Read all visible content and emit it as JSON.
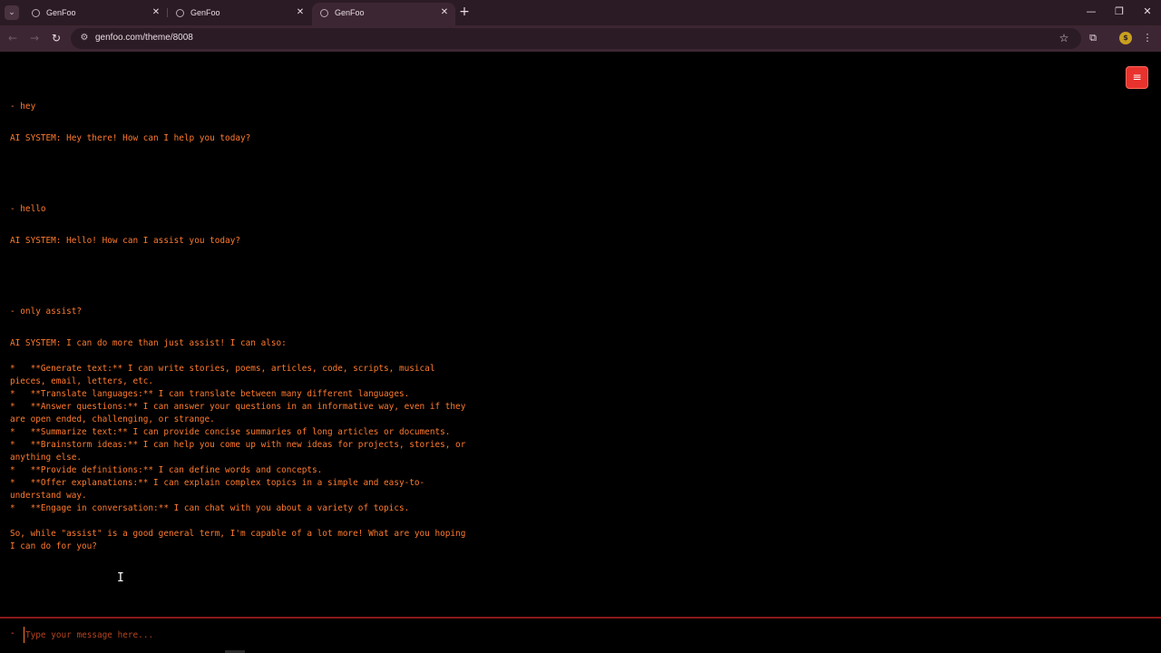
{
  "browser": {
    "tabs": [
      {
        "title": "GenFoo",
        "active": false
      },
      {
        "title": "GenFoo",
        "active": false
      },
      {
        "title": "GenFoo",
        "active": true
      }
    ],
    "url": "genfoo.com/theme/8008"
  },
  "chat": {
    "messages": [
      {
        "role": "user",
        "text": "- hey"
      },
      {
        "role": "ai",
        "text": "AI SYSTEM: Hey there! How can I help you today?"
      },
      {
        "role": "user",
        "text": "- hello"
      },
      {
        "role": "ai",
        "text": "AI SYSTEM: Hello! How can I assist you today?"
      },
      {
        "role": "user",
        "text": "- only assist?"
      },
      {
        "role": "ai",
        "text": "AI SYSTEM: I can do more than just assist! I can also:\n\n*   **Generate text:** I can write stories, poems, articles, code, scripts, musical\npieces, email, letters, etc.\n*   **Translate languages:** I can translate between many different languages.\n*   **Answer questions:** I can answer your questions in an informative way, even if they\nare open ended, challenging, or strange.\n*   **Summarize text:** I can provide concise summaries of long articles or documents.\n*   **Brainstorm ideas:** I can help you come up with new ideas for projects, stories, or\nanything else.\n*   **Provide definitions:** I can define words and concepts.\n*   **Offer explanations:** I can explain complex topics in a simple and easy-to-\nunderstand way.\n*   **Engage in conversation:** I can chat with you about a variety of topics.\n\nSo, while \"assist\" is a good general term, I'm capable of a lot more! What are you hoping\nI can do for you?"
      }
    ],
    "input": {
      "prompt": "-",
      "placeholder": "Type your message here...",
      "value": ""
    }
  },
  "colors": {
    "text": "#ff7a2e",
    "accent": "#e8322e",
    "divider": "#8a1818",
    "background": "#000000"
  },
  "icons": {
    "menu": "hamburger-icon"
  }
}
